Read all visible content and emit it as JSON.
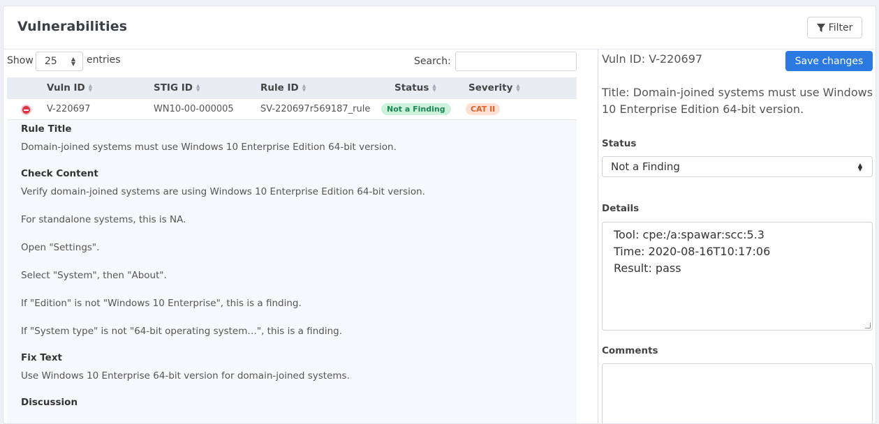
{
  "header": {
    "title": "Vulnerabilities",
    "filter_label": "Filter"
  },
  "table_controls": {
    "show_label": "Show",
    "entries_value": "25",
    "entries_label": "entries",
    "search_label": "Search:",
    "search_value": ""
  },
  "table": {
    "columns": [
      "Vuln ID",
      "STIG ID",
      "Rule ID",
      "Status",
      "Severity"
    ],
    "rows": [
      {
        "vuln_id": "V-220697",
        "stig_id": "WN10-00-000005",
        "rule_id": "SV-220697r569187_rule",
        "status": "Not a Finding",
        "severity": "CAT II"
      }
    ]
  },
  "detail": {
    "rule_title_label": "Rule Title",
    "rule_title": "Domain-joined systems must use Windows 10 Enterprise Edition 64-bit version.",
    "check_content_label": "Check Content",
    "check_lines": [
      "Verify domain-joined systems are using Windows 10 Enterprise Edition 64-bit version.",
      "For standalone systems, this is NA.",
      "Open \"Settings\".",
      "Select \"System\", then \"About\".",
      "If \"Edition\" is not \"Windows 10 Enterprise\", this is a finding.",
      "If \"System type\" is not \"64-bit operating system…\", this is a finding."
    ],
    "fix_text_label": "Fix Text",
    "fix_text": "Use Windows 10 Enterprise 64-bit version for domain-joined systems.",
    "discussion_label": "Discussion"
  },
  "panel": {
    "vuln_id": "Vuln ID: V-220697",
    "save_label": "Save changes",
    "title": "Title: Domain-joined systems must use Windows 10 Enterprise Edition 64-bit version.",
    "status_label": "Status",
    "status_value": "Not a Finding",
    "details_label": "Details",
    "details_lines": [
      "Tool: cpe:/a:spawar:scc:5.3",
      "Time: 2020-08-16T10:17:06",
      "Result: pass"
    ],
    "comments_label": "Comments",
    "comments_value": ""
  },
  "colors": {
    "primary": "#2a7ae2",
    "danger": "#dc3545",
    "success_badge": "#198754",
    "warning_badge": "#e0602b"
  }
}
